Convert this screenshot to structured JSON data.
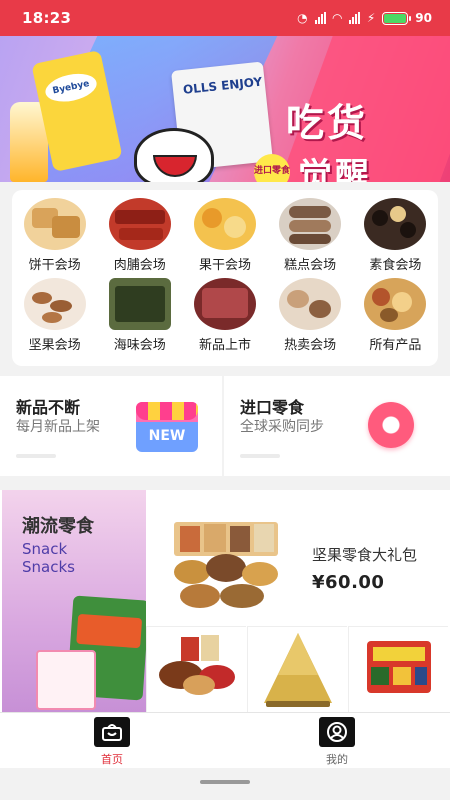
{
  "status_bar": {
    "time": "18:23",
    "battery": "90"
  },
  "banner": {
    "title_line1": "吃货",
    "title_line2": "觉醒",
    "badge": "进口零食",
    "brand_a": "Byebye",
    "brand_b": "OLLS ENJOY"
  },
  "categories": [
    {
      "label": "饼干会场",
      "icon": "biscuit-icon"
    },
    {
      "label": "肉脯会场",
      "icon": "jerky-icon"
    },
    {
      "label": "果干会场",
      "icon": "dried-fruit-icon"
    },
    {
      "label": "糕点会场",
      "icon": "pastry-icon"
    },
    {
      "label": "素食会场",
      "icon": "vegetarian-icon"
    },
    {
      "label": "坚果会场",
      "icon": "nuts-icon"
    },
    {
      "label": "海味会场",
      "icon": "seaweed-icon"
    },
    {
      "label": "新品上市",
      "icon": "new-product-icon"
    },
    {
      "label": "热卖会场",
      "icon": "hot-sale-icon"
    },
    {
      "label": "所有产品",
      "icon": "all-products-icon"
    }
  ],
  "promos": {
    "left": {
      "title": "新品不断",
      "subtitle": "每月新品上架",
      "icon_text": "NEW"
    },
    "right": {
      "title": "进口零食",
      "subtitle": "全球采购同步"
    }
  },
  "trendy": {
    "title": "潮流零食",
    "en_line1": "Snack",
    "en_line2": "Snacks",
    "featured": {
      "name": "坚果零食大礼包",
      "price": "¥60.00"
    }
  },
  "bottom_nav": {
    "home": "首页",
    "me": "我的"
  },
  "colors": {
    "accent": "#e83a48"
  }
}
